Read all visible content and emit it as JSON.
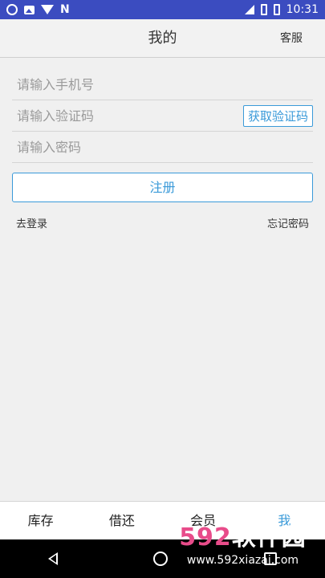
{
  "status_bar": {
    "time": "10:31",
    "icons_left": [
      "sync-icon",
      "image-icon",
      "wifi-question-icon",
      "n-icon"
    ],
    "icons_right": [
      "signal-icon",
      "no-sim-icon",
      "battery-icon"
    ]
  },
  "header": {
    "title": "我的",
    "action": "客服"
  },
  "form": {
    "phone_placeholder": "请输入手机号",
    "code_placeholder": "请输入验证码",
    "code_button": "获取验证码",
    "password_placeholder": "请输入密码"
  },
  "register_button": "注册",
  "links": {
    "login": "去登录",
    "forgot": "忘记密码"
  },
  "tabs": [
    {
      "label": "库存",
      "active": false
    },
    {
      "label": "借还",
      "active": false
    },
    {
      "label": "会员",
      "active": false
    },
    {
      "label": "我",
      "active": true
    }
  ],
  "watermark": {
    "main_a": "592",
    "main_b": "软件园",
    "sub": "www.592xiazai.com"
  },
  "colors": {
    "status_bar": "#3b4cc0",
    "accent": "#3a9ad9",
    "background": "#f0f0f0"
  }
}
